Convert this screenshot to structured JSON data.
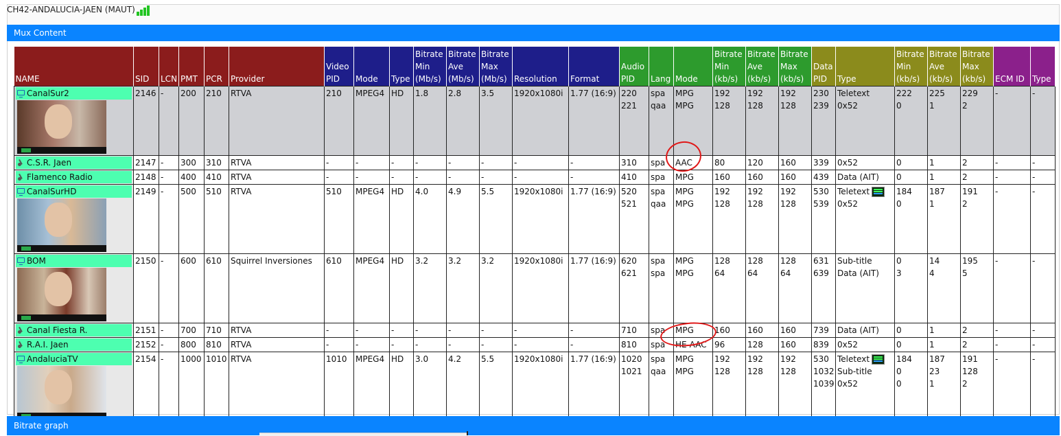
{
  "header": {
    "channel_title": "CH42-ANDALUCIA-JAEN (MAUT)"
  },
  "mux_section": {
    "title": "Mux Content"
  },
  "graph_section": {
    "title": "Bitrate graph"
  },
  "columns": {
    "name": "NAME",
    "sid": "SID",
    "lcn": "LCN",
    "pmt": "PMT",
    "pcr": "PCR",
    "provider": "Provider",
    "video_pid": [
      "Video",
      "PID"
    ],
    "video_mode": "Mode",
    "video_type": "Type",
    "video_min": [
      "Bitrate",
      "Min",
      "(Mb/s)"
    ],
    "video_ave": [
      "Bitrate",
      "Ave",
      "(Mb/s)"
    ],
    "video_max": [
      "Bitrate",
      "Max",
      "(Mb/s)"
    ],
    "resolution": "Resolution",
    "format": "Format",
    "audio_pid": [
      "Audio",
      "PID"
    ],
    "lang": "Lang",
    "audio_mode": "Mode",
    "audio_min": [
      "Bitrate",
      "Min",
      "(kb/s)"
    ],
    "audio_ave": [
      "Bitrate",
      "Ave",
      "(kb/s)"
    ],
    "audio_max": [
      "Bitrate",
      "Max",
      "(kb/s)"
    ],
    "data_pid": [
      "Data",
      "PID"
    ],
    "data_type": "Type",
    "data_min": [
      "Bitrate",
      "Min",
      "(kb/s)"
    ],
    "data_ave": [
      "Bitrate",
      "Ave",
      "(kb/s)"
    ],
    "data_max": [
      "Bitrate",
      "Max",
      "(kb/s)"
    ],
    "ecm_id": "ECM ID",
    "ecm_type": "Type"
  },
  "services": [
    {
      "name": "CanalSur2",
      "icon": "tv-icon",
      "thumb": "t1",
      "sid": "2146",
      "lcn": "-",
      "pmt": "200",
      "pcr": "210",
      "provider": "RTVA",
      "video_pid": "210",
      "video_mode": "MPEG4",
      "video_type": "HD",
      "vmin": "1.8",
      "vave": "2.8",
      "vmax": "3.5",
      "resolution": "1920x1080i",
      "format": "1.77 (16:9)",
      "audio_pid": [
        "220",
        "221"
      ],
      "lang": [
        "spa",
        "qaa"
      ],
      "amode": [
        "MPG",
        "MPG"
      ],
      "amin": [
        "192",
        "128"
      ],
      "aave": [
        "192",
        "128"
      ],
      "amax": [
        "192",
        "128"
      ],
      "data_pid": [
        "230",
        "239"
      ],
      "dtype": [
        "Teletext",
        "0x52"
      ],
      "dmin": [
        "222",
        "0"
      ],
      "dave": [
        "225",
        "1"
      ],
      "dmax": [
        "229",
        "2"
      ],
      "ecm_id": "-",
      "ecm_type": "-"
    },
    {
      "name": "C.S.R. Jaen",
      "icon": "radio-icon",
      "sid": "2147",
      "lcn": "-",
      "pmt": "300",
      "pcr": "310",
      "provider": "RTVA",
      "video_pid": "-",
      "video_mode": "-",
      "video_type": "-",
      "vmin": "-",
      "vave": "-",
      "vmax": "-",
      "resolution": "-",
      "format": "-",
      "audio_pid": [
        "310"
      ],
      "lang": [
        "spa"
      ],
      "amode": [
        "AAC"
      ],
      "amin": [
        "80"
      ],
      "aave": [
        "120"
      ],
      "amax": [
        "160"
      ],
      "data_pid": [
        "339"
      ],
      "dtype": [
        "0x52"
      ],
      "dmin": [
        "0"
      ],
      "dave": [
        "1"
      ],
      "dmax": [
        "2"
      ],
      "ecm_id": "-",
      "ecm_type": "-"
    },
    {
      "name": "Flamenco Radio",
      "icon": "radio-icon",
      "sid": "2148",
      "lcn": "-",
      "pmt": "400",
      "pcr": "410",
      "provider": "RTVA",
      "video_pid": "-",
      "video_mode": "-",
      "video_type": "-",
      "vmin": "-",
      "vave": "-",
      "vmax": "-",
      "resolution": "-",
      "format": "-",
      "audio_pid": [
        "410"
      ],
      "lang": [
        "spa"
      ],
      "amode": [
        "MPG"
      ],
      "amin": [
        "160"
      ],
      "aave": [
        "160"
      ],
      "amax": [
        "160"
      ],
      "data_pid": [
        "439"
      ],
      "dtype": [
        "Data (AIT)"
      ],
      "dmin": [
        "0"
      ],
      "dave": [
        "1"
      ],
      "dmax": [
        "2"
      ],
      "ecm_id": "-",
      "ecm_type": "-"
    },
    {
      "name": "CanalSurHD",
      "icon": "tv-icon",
      "thumb": "t2",
      "sid": "2149",
      "lcn": "-",
      "pmt": "500",
      "pcr": "510",
      "provider": "RTVA",
      "video_pid": "510",
      "video_mode": "MPEG4",
      "video_type": "HD",
      "vmin": "4.0",
      "vave": "4.9",
      "vmax": "5.5",
      "resolution": "1920x1080i",
      "format": "1.77 (16:9)",
      "audio_pid": [
        "520",
        "521"
      ],
      "lang": [
        "spa",
        "qaa"
      ],
      "amode": [
        "MPG",
        "MPG"
      ],
      "amin": [
        "192",
        "128"
      ],
      "aave": [
        "192",
        "128"
      ],
      "amax": [
        "192",
        "128"
      ],
      "data_pid": [
        "530",
        "539"
      ],
      "dtype": [
        "Teletext",
        "0x52"
      ],
      "tt_icon": true,
      "dmin": [
        "184",
        "0"
      ],
      "dave": [
        "187",
        "1"
      ],
      "dmax": [
        "191",
        "2"
      ],
      "ecm_id": "-",
      "ecm_type": "-"
    },
    {
      "name": "BOM",
      "icon": "tv-icon",
      "thumb": "t3",
      "sid": "2150",
      "lcn": "-",
      "pmt": "600",
      "pcr": "610",
      "provider": "Squirrel Inversiones",
      "video_pid": "610",
      "video_mode": "MPEG4",
      "video_type": "HD",
      "vmin": "3.2",
      "vave": "3.2",
      "vmax": "3.2",
      "resolution": "1920x1080i",
      "format": "1.77 (16:9)",
      "audio_pid": [
        "620",
        "621"
      ],
      "lang": [
        "spa",
        "spa"
      ],
      "amode": [
        "MPG",
        "MPG"
      ],
      "amin": [
        "128",
        "64"
      ],
      "aave": [
        "128",
        "64"
      ],
      "amax": [
        "128",
        "64"
      ],
      "data_pid": [
        "631",
        "639"
      ],
      "dtype": [
        "Sub-title",
        "Data (AIT)"
      ],
      "dmin": [
        "0",
        "3"
      ],
      "dave": [
        "14",
        "4"
      ],
      "dmax": [
        "195",
        "5"
      ],
      "ecm_id": "-",
      "ecm_type": "-"
    },
    {
      "name": "Canal Fiesta R.",
      "icon": "radio-icon",
      "sid": "2151",
      "lcn": "-",
      "pmt": "700",
      "pcr": "710",
      "provider": "RTVA",
      "video_pid": "-",
      "video_mode": "-",
      "video_type": "-",
      "vmin": "-",
      "vave": "-",
      "vmax": "-",
      "resolution": "-",
      "format": "-",
      "audio_pid": [
        "710"
      ],
      "lang": [
        "spa"
      ],
      "amode": [
        "MPG"
      ],
      "amin": [
        "160"
      ],
      "aave": [
        "160"
      ],
      "amax": [
        "160"
      ],
      "data_pid": [
        "739"
      ],
      "dtype": [
        "Data (AIT)"
      ],
      "dmin": [
        "0"
      ],
      "dave": [
        "1"
      ],
      "dmax": [
        "2"
      ],
      "ecm_id": "-",
      "ecm_type": "-"
    },
    {
      "name": "R.A.I. Jaen",
      "icon": "radio-icon",
      "sid": "2152",
      "lcn": "-",
      "pmt": "800",
      "pcr": "810",
      "provider": "RTVA",
      "video_pid": "-",
      "video_mode": "-",
      "video_type": "-",
      "vmin": "-",
      "vave": "-",
      "vmax": "-",
      "resolution": "-",
      "format": "-",
      "audio_pid": [
        "810"
      ],
      "lang": [
        "spa"
      ],
      "amode": [
        "HE-AAC"
      ],
      "amin": [
        "96"
      ],
      "aave": [
        "128"
      ],
      "amax": [
        "160"
      ],
      "data_pid": [
        "839"
      ],
      "dtype": [
        "0x52"
      ],
      "dmin": [
        "0"
      ],
      "dave": [
        "1"
      ],
      "dmax": [
        "2"
      ],
      "ecm_id": "-",
      "ecm_type": "-"
    },
    {
      "name": "AndaluciaTV",
      "icon": "tv-icon",
      "thumb": "t4",
      "sid": "2154",
      "lcn": "-",
      "pmt": "1000",
      "pcr": "1010",
      "provider": "RTVA",
      "video_pid": "1010",
      "video_mode": "MPEG4",
      "video_type": "HD",
      "vmin": "3.0",
      "vave": "4.2",
      "vmax": "5.5",
      "resolution": "1920x1080i",
      "format": "1.77 (16:9)",
      "audio_pid": [
        "1020",
        "1021"
      ],
      "lang": [
        "spa",
        "qaa"
      ],
      "amode": [
        "MPG",
        "MPG"
      ],
      "amin": [
        "192",
        "128"
      ],
      "aave": [
        "192",
        "128"
      ],
      "amax": [
        "192",
        "128"
      ],
      "data_pid": [
        "530",
        "1032",
        "1039"
      ],
      "dtype": [
        "Teletext",
        "Sub-title",
        "0x52"
      ],
      "tt_icon": true,
      "dmin": [
        "184",
        "0",
        "0"
      ],
      "dave": [
        "187",
        "23",
        "1"
      ],
      "dmax": [
        "191",
        "128",
        "2"
      ],
      "ecm_id": "-",
      "ecm_type": "-"
    }
  ],
  "colors": {
    "group_service": "#8b1c1c",
    "group_video": "#1e1e8a",
    "group_audio": "#2d9b2d",
    "group_data": "#8b8b1c",
    "group_ecm": "#8b208b",
    "name_highlight": "#4dffb0",
    "section_bar": "#0a84ff"
  }
}
